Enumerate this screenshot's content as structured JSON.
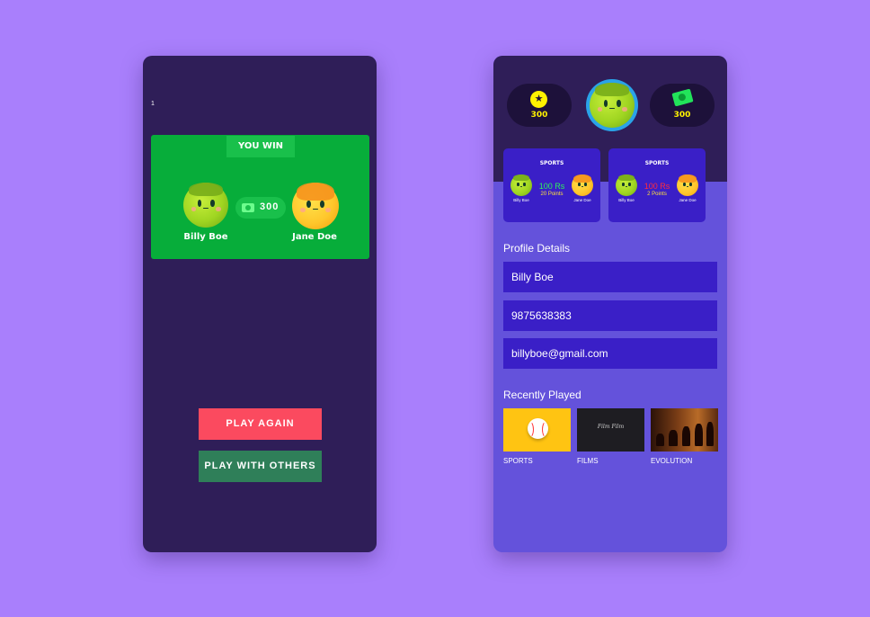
{
  "game_result": {
    "marker": "1",
    "result_label": "YOU WIN",
    "stake": "300",
    "player_one": "Billy Boe",
    "player_two": "Jane Doe",
    "play_again_label": "PLAY AGAIN",
    "play_with_others_label": "PLAY WITH OTHERS"
  },
  "profile": {
    "coins": "300",
    "cash": "300",
    "matches": [
      {
        "title": "SPORTS",
        "amount": "100 Rs",
        "points": "20 Points",
        "player_left": "Billy Boe",
        "player_right": "Jane Doe",
        "outcome": "win"
      },
      {
        "title": "SPORTS",
        "amount": "100 Rs",
        "points": "2 Points",
        "player_left": "Billy Boe",
        "player_right": "Jane Doe",
        "outcome": "loss"
      }
    ],
    "details_heading": "Profile Details",
    "name": "Billy Boe",
    "phone": "9875638383",
    "email": "billyboe@gmail.com",
    "recent_heading": "Recently Played",
    "recent": [
      {
        "label": "SPORTS",
        "icon": "baseball-icon"
      },
      {
        "label": "FILMS",
        "art_text": "Film Film",
        "icon": "film-title-art"
      },
      {
        "label": "EVOLUTION",
        "icon": "evolution-art"
      }
    ]
  },
  "colors": {
    "background": "#a97ffc",
    "dark_panel": "#2f1e58",
    "win_green": "#07ad3a",
    "play_again": "#fb4a5f",
    "play_others": "#2f7f59",
    "profile_bg": "#6452db",
    "field_bg": "#3a1fc7",
    "win_amount": "#2ff05d",
    "loss_amount": "#ff2b3c",
    "gold": "#fff200"
  }
}
